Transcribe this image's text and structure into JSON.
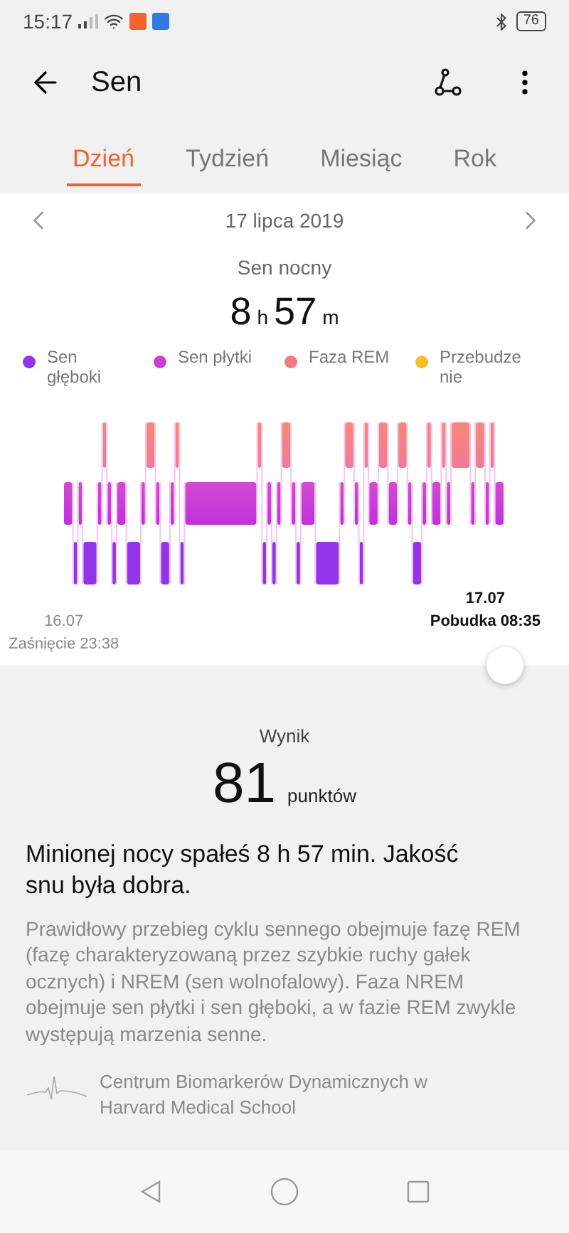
{
  "status_bar": {
    "time": "15:17",
    "battery": "76"
  },
  "header": {
    "title": "Sen"
  },
  "tabs": [
    {
      "label": "Dzień",
      "selected": true
    },
    {
      "label": "Tydzień",
      "selected": false
    },
    {
      "label": "Miesiąc",
      "selected": false
    },
    {
      "label": "Rok",
      "selected": false
    }
  ],
  "date": "17 lipca 2019",
  "summary": {
    "label": "Sen nocny",
    "hours": "8",
    "hours_unit": "h",
    "minutes": "57",
    "minutes_unit": "m"
  },
  "legend": [
    {
      "label": "Sen głęboki",
      "color": "#9333ea"
    },
    {
      "label": "Sen płytki",
      "color": "#c83fd6"
    },
    {
      "label": "Faza REM",
      "color": "#f07a80"
    },
    {
      "label": "Przebudze nie",
      "color": "#fbbf24"
    }
  ],
  "chart": {
    "start_date": "16.07",
    "start_label": "Zaśnięcie 23:38",
    "end_date": "17.07",
    "end_label": "Pobudka 08:35"
  },
  "score": {
    "label": "Wynik",
    "value": "81",
    "unit": "punktów"
  },
  "headline": "Minionej nocy spałeś 8 h 57 min. Jakość snu była dobra.",
  "description": "Prawidłowy przebieg cyklu sennego obejmuje fazę REM (fazę charakteryzowaną przez szybkie ruchy gałek ocznych) i NREM (sen wolnofalowy). Faza NREM obejmuje sen płytki i sen głęboki, a w fazie REM zwykle występują marzenia senne.",
  "source": "Centrum Biomarkerów Dynamicznych w Harvard Medical School"
}
